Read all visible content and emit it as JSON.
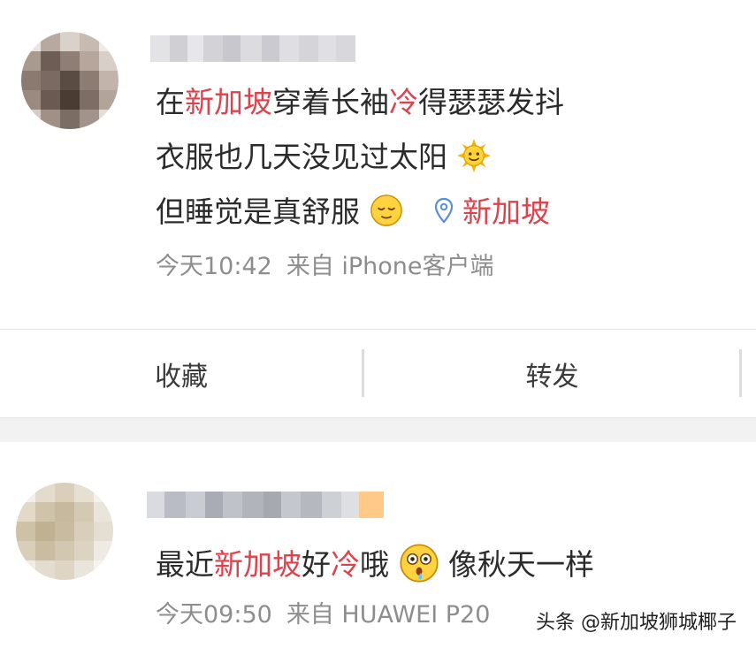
{
  "posts": [
    {
      "lines": [
        [
          {
            "t": "在"
          },
          {
            "t": "新加坡",
            "hl": true
          },
          {
            "t": "穿着长袖"
          },
          {
            "t": "冷",
            "hl": true
          },
          {
            "t": "得瑟瑟发抖"
          }
        ],
        [
          {
            "t": "衣服也几天没见过太阳"
          }
        ],
        [
          {
            "t": "但睡觉是真舒服"
          }
        ]
      ],
      "location": "新加坡",
      "time": "今天10:42",
      "source": "来自 iPhone客户端"
    },
    {
      "lines": [
        [
          {
            "t": "最近"
          },
          {
            "t": "新加坡",
            "hl": true
          },
          {
            "t": "好"
          },
          {
            "t": "冷",
            "hl": true
          },
          {
            "t": "哦"
          }
        ],
        [
          {
            "t": "像秋天一样"
          }
        ]
      ],
      "time": "今天09:50",
      "source": "来自 HUAWEI P20"
    }
  ],
  "actions": {
    "favorite": "收藏",
    "repost": "转发"
  },
  "watermark": "头条 @新加坡狮城椰子",
  "colors": {
    "highlight": "#e0424b",
    "meta": "#8d8d8d"
  },
  "icons": [
    "sun-emoji-icon",
    "relieved-face-emoji-icon",
    "location-pin-icon",
    "flushed-face-emoji-icon"
  ]
}
